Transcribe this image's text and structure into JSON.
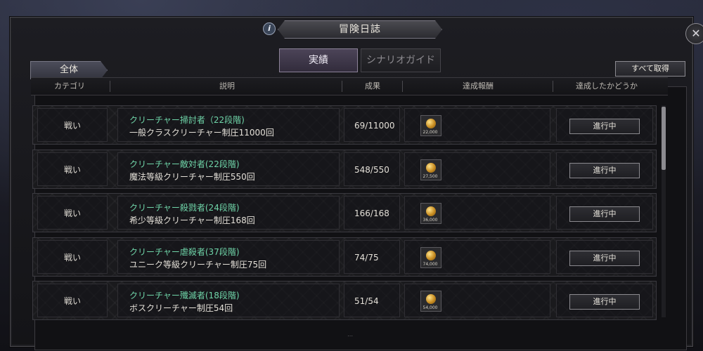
{
  "window": {
    "title": "冒険日誌"
  },
  "tabs": [
    {
      "label": "実績",
      "active": true
    },
    {
      "label": "シナリオガイド",
      "active": false
    }
  ],
  "category_filter": "全体",
  "claim_all_label": "すべて取得",
  "columns": [
    "カテゴリ",
    "説明",
    "成果",
    "達成報酬",
    "達成したかどうか"
  ],
  "rows": [
    {
      "category": "戦い",
      "name": "クリーチャー掃討者（22段階)",
      "description": "一般クラスクリーチャー制圧11000回",
      "progress": "69/11000",
      "reward": "22,000",
      "status": "進行中"
    },
    {
      "category": "戦い",
      "name": "クリーチャー敵対者(22段階)",
      "description": "魔法等級クリーチャー制圧550回",
      "progress": "548/550",
      "reward": "27,500",
      "status": "進行中"
    },
    {
      "category": "戦い",
      "name": "クリーチャー殺戮者(24段階)",
      "description": "希少等級クリーチャー制圧168回",
      "progress": "166/168",
      "reward": "36,000",
      "status": "進行中"
    },
    {
      "category": "戦い",
      "name": "クリーチャー虐殺者(37段階)",
      "description": "ユニーク等級クリーチャー制圧75回",
      "progress": "74/75",
      "reward": "74,000",
      "status": "進行中"
    },
    {
      "category": "戦い",
      "name": "クリーチャー殲滅者(18段階)",
      "description": "ボスクリーチャー制圧54回",
      "progress": "51/54",
      "reward": "54,000",
      "status": "進行中"
    }
  ],
  "icons": {
    "info": "info-icon",
    "close": "close-icon",
    "reward": "gold-coin-icon"
  },
  "colors": {
    "quest_name": "#6fd4a8",
    "active_tab": "#4c4458"
  }
}
